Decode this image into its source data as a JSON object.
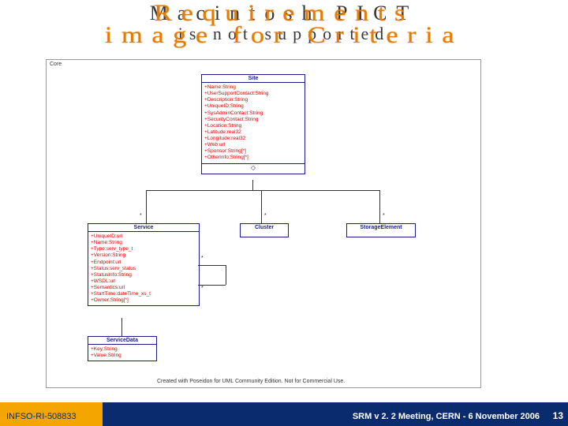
{
  "title_overlay": {
    "line_upper_a": "Macintosh PICT",
    "line_upper_b": "Requirements",
    "line_lower_a": "is not supported",
    "line_lower_b": "image for Criteria"
  },
  "pkg_label": "Core",
  "classes": {
    "site": {
      "name": "Site",
      "attrs": [
        "+Name:String",
        "+UserSupportContact:String",
        "+Description:String",
        "+UniqueID:String",
        "+SysAdminContact:String",
        "+SecurityContact:String",
        "+Location:String",
        "+Latitude:real32",
        "+Longitude:real32",
        "+Web:url",
        "+Sponsor:String[*]",
        "+OtherInfo:String[*]"
      ]
    },
    "service": {
      "name": "Service",
      "attrs": [
        "+UniqueID:url",
        "+Name:String",
        "+Type:serv_type_t",
        "+Version:String",
        "+Endpoint:url",
        "+Status:serv_status",
        "+StatusInfo:String",
        "+WSDL:url",
        "+Semantics:url",
        "+StartTime:dateTime_xs_t",
        "+Owner:String[*]"
      ]
    },
    "cluster": {
      "name": "Cluster"
    },
    "storage": {
      "name": "StorageElement"
    },
    "servicedata": {
      "name": "ServiceData",
      "attrs": [
        "+Key:String",
        "+Value:String"
      ]
    }
  },
  "credit": "Created with Poseidon for UML Community Edition. Not for Commercial Use.",
  "footer": {
    "left": "INFSO-RI-508833",
    "right": "SRM v 2. 2 Meeting, CERN - 6 November 2006",
    "page": "13"
  }
}
